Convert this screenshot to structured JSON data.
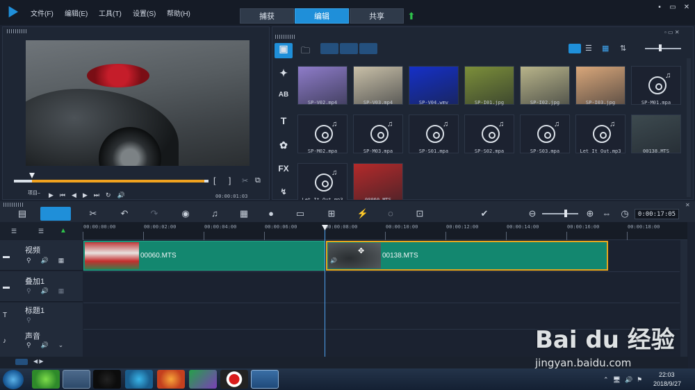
{
  "menu": [
    "文件(F)",
    "编辑(E)",
    "工具(T)",
    "设置(S)",
    "帮助(H)"
  ],
  "mode_tabs": [
    "捕获",
    "编辑",
    "共享"
  ],
  "window_buttons": [
    "▪",
    "▭",
    "✕"
  ],
  "preview": {
    "project_label": "项目–",
    "timecode": "00:00:01:03"
  },
  "library": {
    "items": [
      {
        "label": "SP-V02.mp4",
        "kind": "video",
        "color": "#8e7cc9"
      },
      {
        "label": "SP-V03.mp4",
        "kind": "video",
        "color": "#c9c0a8"
      },
      {
        "label": "SP-V04.wmv",
        "kind": "video",
        "color": "#1530c8"
      },
      {
        "label": "SP-I01.jpg",
        "kind": "image",
        "color": "#7c8f3a"
      },
      {
        "label": "SP-I02.jpg",
        "kind": "image",
        "color": "#b8b48a"
      },
      {
        "label": "SP-I03.jpg",
        "kind": "image",
        "color": "#d9a77a"
      },
      {
        "label": "SP-M01.mpa",
        "kind": "audio",
        "color": ""
      },
      {
        "label": "SP-M02.mpa",
        "kind": "audio",
        "color": ""
      },
      {
        "label": "SP-M03.mpa",
        "kind": "audio",
        "color": ""
      },
      {
        "label": "SP-S01.mpa",
        "kind": "audio",
        "color": ""
      },
      {
        "label": "SP-S02.mpa",
        "kind": "audio",
        "color": ""
      },
      {
        "label": "SP-S03.mpa",
        "kind": "audio",
        "color": ""
      },
      {
        "label": "Let It Out.mp3",
        "kind": "audio",
        "color": ""
      },
      {
        "label": "00138.MTS",
        "kind": "video",
        "color": "#3d4a4f"
      },
      {
        "label": "Let It Out.mp3",
        "kind": "audio",
        "color": ""
      },
      {
        "label": "00060.MTS",
        "kind": "video",
        "color": "#b42a2a"
      }
    ]
  },
  "side_tools": [
    "▣",
    "✦",
    "AB",
    "T",
    "✿",
    "FX",
    "↯"
  ],
  "timeline": {
    "timecode": "0:00:17:05",
    "ruler": [
      "00:00:00:00",
      "00:00:02:00",
      "00:00:04:00",
      "00:00:06:00",
      "00:00:08:00",
      "00:00:10:00",
      "00:00:12:00",
      "00:00:14:00",
      "00:00:16:00",
      "00:00:18:00"
    ],
    "tracks": [
      "视频",
      "叠加1",
      "标题1",
      "声音"
    ],
    "clips": [
      {
        "name": "00060.MTS"
      },
      {
        "name": "00138.MTS"
      }
    ]
  },
  "taskbar": {
    "time": "22:03",
    "date": "2018/9/27"
  },
  "watermark": {
    "brand": "Bai du 经验",
    "url": "jingyan.baidu.com"
  },
  "colors": {
    "accent": "#1f8fd9",
    "clip": "#13876f"
  }
}
